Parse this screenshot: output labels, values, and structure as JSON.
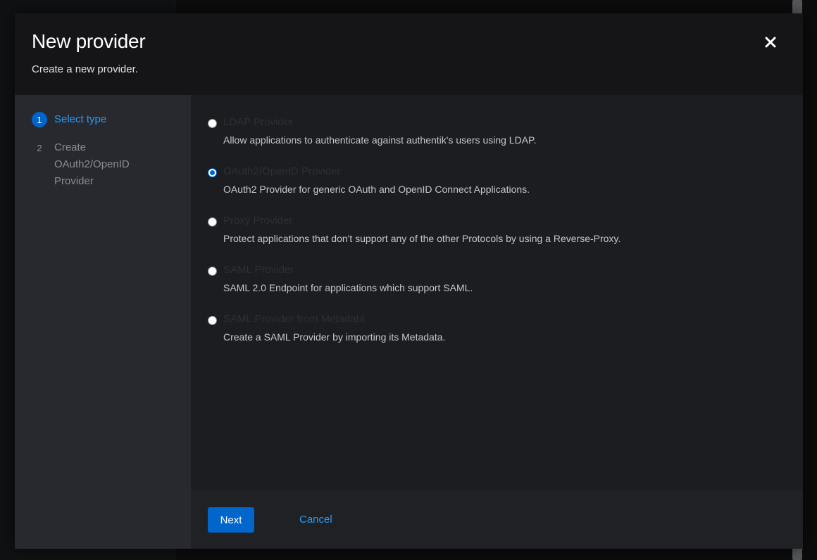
{
  "modal": {
    "title": "New provider",
    "subtitle": "Create a new provider.",
    "close_icon": "close-icon"
  },
  "wizard_nav": {
    "steps": [
      {
        "number": "1",
        "label": "Select type",
        "active": true
      },
      {
        "number": "2",
        "label": "Create OAuth2/OpenID Provider",
        "active": false
      }
    ]
  },
  "options": [
    {
      "label": "LDAP Provider",
      "description": "Allow applications to authenticate against authentik's users using LDAP.",
      "selected": false
    },
    {
      "label": "OAuth2/OpenID Provider",
      "description": "OAuth2 Provider for generic OAuth and OpenID Connect Applications.",
      "selected": true
    },
    {
      "label": "Proxy Provider",
      "description": "Protect applications that don't support any of the other Protocols by using a Reverse-Proxy.",
      "selected": false
    },
    {
      "label": "SAML Provider",
      "description": "SAML 2.0 Endpoint for applications which support SAML.",
      "selected": false
    },
    {
      "label": "SAML Provider from Metadata",
      "description": "Create a SAML Provider by importing its Metadata.",
      "selected": false
    }
  ],
  "footer": {
    "next_label": "Next",
    "cancel_label": "Cancel"
  },
  "colors": {
    "accent": "#0066cc",
    "link": "#2b9af3",
    "modal_bg": "#1b1d21",
    "nav_bg": "#27292e"
  }
}
